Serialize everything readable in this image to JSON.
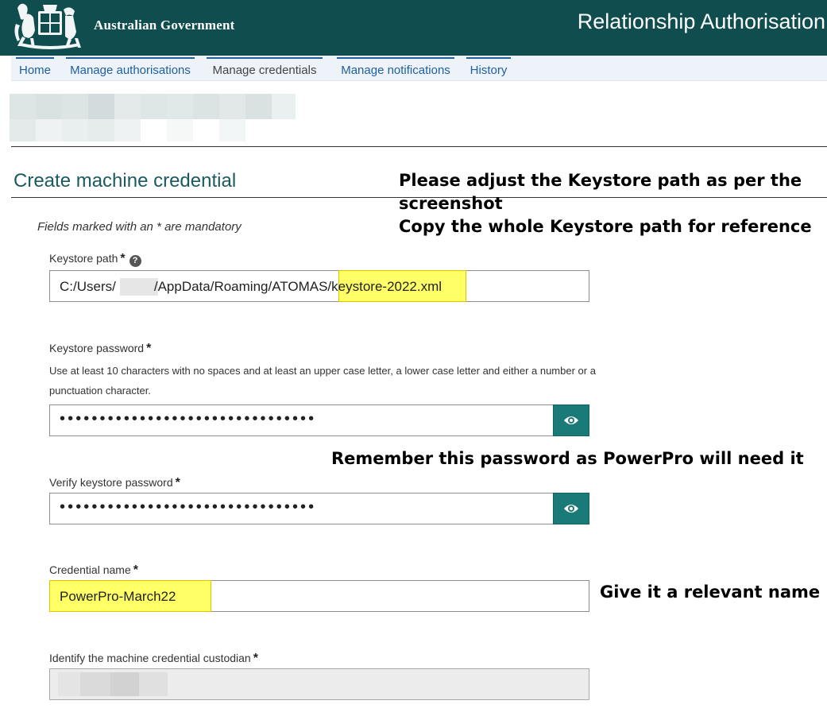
{
  "header": {
    "gov_name": "Australian Government",
    "app_title": "Relationship Authorisation"
  },
  "nav": {
    "items": [
      {
        "label": "Home"
      },
      {
        "label": "Manage authorisations"
      },
      {
        "label": "Manage credentials",
        "active": true
      },
      {
        "label": "Manage notifications"
      },
      {
        "label": "History"
      }
    ]
  },
  "form": {
    "title": "Create machine credential",
    "mandatory_note": "Fields marked with an * are mandatory",
    "keystore_path": {
      "label": "Keystore path",
      "required_mark": "*",
      "help_icon": "question-circle-icon",
      "value_prefix": "C:/Users/",
      "value_middle": "/AppData/Roaming/ATOMAS/",
      "value_highlight": "keystore-2022.xml"
    },
    "keystore_password": {
      "label": "Keystore password",
      "required_mark": "*",
      "hint": "Use at least 10 characters with no spaces and at least an upper case letter, a lower case letter and either a number or a punctuation character.",
      "masked_value": "••••••••••••••••••••••••••••••••",
      "toggle_icon": "eye-icon"
    },
    "verify_password": {
      "label": "Verify keystore password",
      "required_mark": "*",
      "masked_value": "••••••••••••••••••••••••••••••••",
      "toggle_icon": "eye-icon"
    },
    "credential_name": {
      "label": "Credential name",
      "required_mark": "*",
      "value": "PowerPro-March22"
    },
    "custodian": {
      "label": "Identify the machine credential custodian",
      "required_mark": "*"
    }
  },
  "annotations": {
    "keystore_line1": "Please adjust the Keystore path as per the",
    "keystore_line2": "screenshot",
    "keystore_line3": "Copy the whole Keystore path for reference",
    "password_note": "Remember this password as PowerPro will need it",
    "name_note": "Give it a relevant name"
  },
  "colors": {
    "header_bg": "#0f4d4f",
    "nav_bg": "#eef3fa",
    "link": "#1d5f9e",
    "title": "#1a5a60",
    "eye_button": "#1a7a78",
    "highlight": "#ffff66"
  }
}
